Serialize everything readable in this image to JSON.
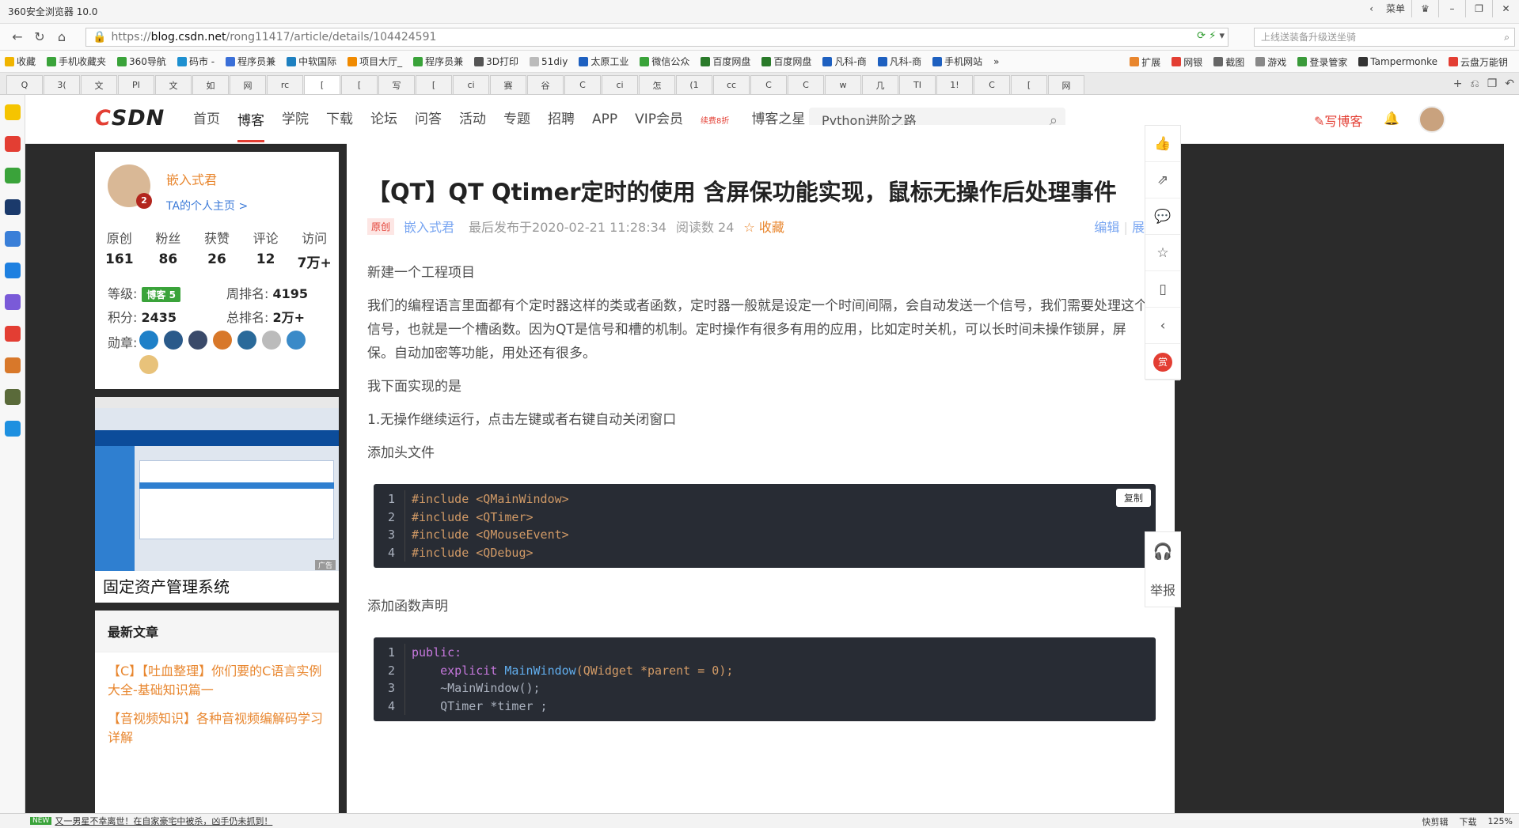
{
  "browser": {
    "title": "360安全浏览器 10.0",
    "menu_label": "菜单",
    "url_scheme": "https://",
    "url_host": "blog.csdn.net",
    "url_path": "/rong11417/article/details/104424591",
    "search_placeholder": "上线送装备升级送坐骑",
    "bookmarks": [
      "收藏",
      "手机收藏夹",
      "360导航",
      "码市 -",
      "程序员兼",
      "中软国际",
      "项目大厅_",
      "程序员兼",
      "3D打印",
      "51diy",
      "太原工业",
      "微信公众",
      "百度网盘",
      "百度网盘",
      "凡科-商",
      "凡科-商",
      "手机网站"
    ],
    "bookmarks_right": [
      "扩展",
      "网银",
      "截图",
      "游戏",
      "登录管家",
      "Tampermonke",
      "云盘万能钥"
    ],
    "tabs": [
      "Q",
      "3(",
      "文",
      "PI",
      "文",
      "如",
      "网",
      "rc",
      "[",
      "[",
      "写",
      "[",
      "ci",
      "赛",
      "谷",
      "C",
      "ci",
      "怎",
      "(1",
      "cc",
      "C",
      "C",
      "w",
      "几",
      "TI",
      "1!",
      "C",
      "[",
      "网"
    ],
    "status_msg": "又一男星不幸离世！在自家豪宅中被杀，凶手仍未抓到！",
    "status_new": "NEW",
    "status_right": [
      "快剪辑",
      "下载",
      "125%"
    ]
  },
  "csdn": {
    "logo_c": "C",
    "logo_rest": "SDN",
    "nav": [
      "首页",
      "博客",
      "学院",
      "下载",
      "论坛",
      "问答",
      "活动",
      "专题",
      "招聘",
      "APP"
    ],
    "vip": "VIP会员",
    "vip_tag": "续费8折",
    "star": "博客之星",
    "search": "Python进阶之路",
    "write": "写博客"
  },
  "profile": {
    "name": "嵌入式君",
    "home": "TA的个人主页 >",
    "years": "2",
    "stats": [
      {
        "k": "原创",
        "v": "161"
      },
      {
        "k": "粉丝",
        "v": "86"
      },
      {
        "k": "获赞",
        "v": "26"
      },
      {
        "k": "评论",
        "v": "12"
      },
      {
        "k": "访问",
        "v": "7万+"
      }
    ],
    "level_label": "等级:",
    "level_badge": "博客 5",
    "week_label": "周排名:",
    "week": "4195",
    "points_label": "积分:",
    "points": "2435",
    "total_label": "总排名:",
    "total": "2万+",
    "medal_label": "勋章:"
  },
  "ad": {
    "title": "固定资产管理系统",
    "tag": "广告"
  },
  "latest": {
    "heading": "最新文章",
    "items": [
      "【C】【吐血整理】你们要的C语言实例大全-基础知识篇一",
      "【音视频知识】各种音视频编解码学习详解"
    ]
  },
  "article": {
    "title": "【QT】QT Qtimer定时的使用 含屏保功能实现，鼠标无操作后处理事件",
    "orig": "原创",
    "author": "嵌入式君",
    "time": "最后发布于2020-02-21 11:28:34",
    "reads": "阅读数 24",
    "fav": "收藏",
    "edit": "编辑",
    "expand": "展开",
    "p1": "新建一个工程项目",
    "p2": "我们的编程语言里面都有个定时器这样的类或者函数，定时器一般就是设定一个时间间隔，会自动发送一个信号，我们需要处理这个信号，也就是一个槽函数。因为QT是信号和槽的机制。定时操作有很多有用的应用，比如定时关机，可以长时间未操作锁屏，屏保。自动加密等功能，用处还有很多。",
    "p3": "我下面实现的是",
    "p4": "1.无操作继续运行，点击左键或者右键自动关闭窗口",
    "p5": "添加头文件",
    "copy": "复制",
    "code1": [
      "#include <QMainWindow>",
      "#include <QTimer>",
      "#include <QMouseEvent>",
      "#include <QDebug>"
    ],
    "p6": "添加函数声明",
    "code2_l1": "public:",
    "code2_l2_kw": "explicit",
    "code2_l2_fn": "MainWindow",
    "code2_l2_rest": "(QWidget *parent = 0);",
    "code2_l3": "~MainWindow();",
    "code2_l4": "QTimer *timer ;"
  },
  "toolbar": {
    "reward": "赏",
    "report": "举报"
  }
}
